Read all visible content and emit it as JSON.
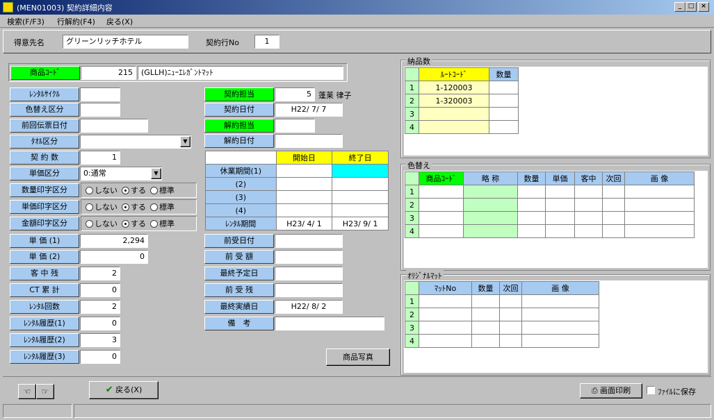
{
  "window": {
    "title": "(MEN01003) 契約詳細内容",
    "icon": "app-icon",
    "controls": [
      "_",
      "□",
      "×"
    ]
  },
  "menu": [
    "検索(F/F3)",
    "行解約(F4)",
    "戻る(X)"
  ],
  "header": {
    "customer_label": "得意先名",
    "customer_value": "グリーンリッチホテル",
    "line_label": "契約行No",
    "line_value": "1"
  },
  "product": {
    "label": "商品ｺｰﾄﾞ",
    "code": "215",
    "name": "(GLLH)ﾆｭｰｴﾚｶﾞﾝﾄﾏｯﾄ"
  },
  "left": {
    "rental_cycle": {
      "label": "ﾚﾝﾀﾙｻｲｸﾙ",
      "value": ""
    },
    "color_change": {
      "label": "色替え区分",
      "value": ""
    },
    "prev_slip": {
      "label": "前回伝票日付",
      "value": ""
    },
    "towel": {
      "label": "ﾀｵﾙ区分",
      "value": ""
    },
    "contract_count": {
      "label": "契 約 数",
      "value": "1"
    },
    "unit_type": {
      "label": "単価区分",
      "value": "0:通常"
    },
    "qty_print": {
      "label": "数量印字区分"
    },
    "price_print": {
      "label": "単価印字区分"
    },
    "amount_print": {
      "label": "金額印字区分"
    },
    "radio_opts": [
      "しない",
      "する",
      "標準"
    ],
    "price1": {
      "label": "単 価 (1)",
      "value": "2,294"
    },
    "price2": {
      "label": "単 価 (2)",
      "value": "0"
    },
    "guest": {
      "label": "客 中 残",
      "value": "2"
    },
    "ct": {
      "label": "CT 累 計",
      "value": "0"
    },
    "rental_count": {
      "label": "ﾚﾝﾀﾙ回数",
      "value": "2"
    },
    "hist1": {
      "label": "ﾚﾝﾀﾙ履歴(1)",
      "value": "0"
    },
    "hist2": {
      "label": "ﾚﾝﾀﾙ履歴(2)",
      "value": "3"
    },
    "hist3": {
      "label": "ﾚﾝﾀﾙ履歴(3)",
      "value": "0"
    }
  },
  "mid": {
    "contract_staff": {
      "label": "契約担当",
      "code": "5",
      "name": "蓬莱 律子"
    },
    "contract_date": {
      "label": "契約日付",
      "value": "H22/ 7/ 7"
    },
    "cancel_staff": {
      "label": "解約担当",
      "value": ""
    },
    "cancel_date": {
      "label": "解約日付",
      "value": ""
    },
    "period_headers": [
      "開始日",
      "終了日"
    ],
    "periods": [
      {
        "label": "休業期間(1)",
        "start": "",
        "end": ""
      },
      {
        "label": "(2)",
        "start": "",
        "end": ""
      },
      {
        "label": "(3)",
        "start": "",
        "end": ""
      },
      {
        "label": "(4)",
        "start": "",
        "end": ""
      },
      {
        "label": "ﾚﾝﾀﾙ期間",
        "start": "H23/ 4/ 1",
        "end": "H23/ 9/ 1"
      }
    ],
    "pre_date": {
      "label": "前受日付",
      "value": ""
    },
    "pre_amount": {
      "label": "前 受 額",
      "value": ""
    },
    "last_plan": {
      "label": "最終予定日",
      "value": ""
    },
    "pre_remain": {
      "label": "前 受 残",
      "value": ""
    },
    "last_actual": {
      "label": "最終実績日",
      "value": "H22/ 8/ 2"
    },
    "remarks": {
      "label": "備　考",
      "value": ""
    },
    "photo_button": "商品写真"
  },
  "delivery": {
    "title": "納品数",
    "headers": [
      "ﾙｰﾄｺｰﾄﾞ",
      "数量"
    ],
    "rows": [
      {
        "no": "1",
        "route": "1-120003",
        "qty": ""
      },
      {
        "no": "2",
        "route": "1-320003",
        "qty": ""
      },
      {
        "no": "3",
        "route": "",
        "qty": ""
      },
      {
        "no": "4",
        "route": "",
        "qty": ""
      }
    ]
  },
  "colorchg": {
    "title": "色替え",
    "headers": [
      "商品ｺｰﾄﾞ",
      "略 称",
      "数量",
      "単価",
      "客中",
      "次回",
      "画 像"
    ],
    "rows": [
      "1",
      "2",
      "3",
      "4"
    ]
  },
  "original": {
    "title": "ｵﾘｼﾞﾅﾙﾏｯﾄ",
    "headers": [
      "ﾏｯﾄNo",
      "数量",
      "次回",
      "画 像"
    ],
    "rows": [
      "1",
      "2",
      "3",
      "4"
    ]
  },
  "footer": {
    "back_button": "戻る(X)",
    "print_button": "画面印刷",
    "save_label": "ﾌｧｲﾙに保存"
  }
}
